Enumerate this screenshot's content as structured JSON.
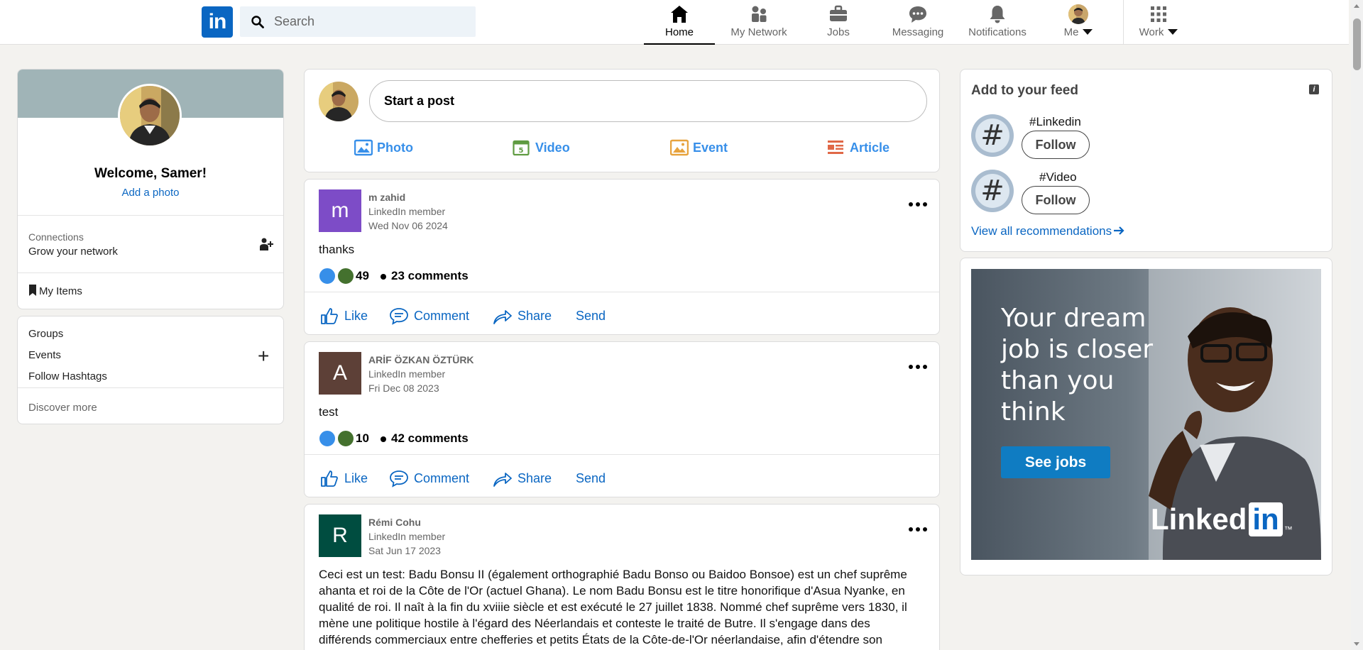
{
  "brand": {
    "logo_text": "in",
    "primary_color": "#0a66c2"
  },
  "search": {
    "placeholder": "Search"
  },
  "nav": {
    "home": "Home",
    "network": "My Network",
    "jobs": "Jobs",
    "messaging": "Messaging",
    "notifications": "Notifications",
    "me": "Me",
    "work": "Work",
    "active": "Home"
  },
  "profile": {
    "welcome": "Welcome, Samer!",
    "add_photo": "Add a photo",
    "connections_title": "Connections",
    "connections_sub": "Grow your network",
    "my_items": "My Items"
  },
  "side_links": {
    "groups": "Groups",
    "events": "Events",
    "follow_hashtags": "Follow Hashtags",
    "discover": "Discover more"
  },
  "composer": {
    "prompt": "Start a post",
    "actions": {
      "photo": "Photo",
      "video": "Video",
      "event": "Event",
      "article": "Article"
    },
    "action_colors": {
      "photo": "#378fe9",
      "video": "#5f9b41",
      "event": "#e7a33e",
      "article": "#e06847"
    }
  },
  "posts": [
    {
      "initial": "m",
      "avatar_color": "#7d4cc7",
      "name": "m zahid",
      "role": "LinkedIn member",
      "date": "Wed Nov 06 2024",
      "text": "thanks",
      "reaction_count": "49",
      "comments": "23 comments"
    },
    {
      "initial": "A",
      "avatar_color": "#5d4037",
      "name": "ARİF ÖZKAN ÖZTÜRK",
      "role": "LinkedIn member",
      "date": "Fri Dec 08 2023",
      "text": "test",
      "reaction_count": "10",
      "comments": "42 comments"
    },
    {
      "initial": "R",
      "avatar_color": "#004d40",
      "name": "Rémi Cohu",
      "role": "LinkedIn member",
      "date": "Sat Jun 17 2023",
      "text": "Ceci est un test: Badu Bonsu II (également orthographié Badu Bonso ou Baidoo Bonsoe) est un chef suprême ahanta et roi de la Côte de l'Or (actuel Ghana). Le nom Badu Bonsu est le titre honorifique d'Asua Nyanke, en qualité de roi. Il naît à la fin du xviiie siècle et est exécuté le 27 juillet 1838. Nommé chef suprême vers 1830, il mène une politique hostile à l'égard des Néerlandais et conteste le traité de Butre. Il s'engage dans des différends commerciaux entre chefferies et petits États de la Côte-de-l'Or néerlandaise, afin d'étendre son"
    }
  ],
  "post_actions": {
    "like": "Like",
    "comment": "Comment",
    "share": "Share",
    "send": "Send"
  },
  "feed_reco": {
    "title": "Add to your feed",
    "items": [
      {
        "tag": "#Linkedin",
        "button": "Follow"
      },
      {
        "tag": "#Video",
        "button": "Follow"
      }
    ],
    "view_all": "View all recommendations"
  },
  "ad": {
    "headline": "Your dream job is closer than you think",
    "button": "See jobs",
    "logo_word": "Linked",
    "logo_in": "in",
    "logo_tm": "™"
  }
}
